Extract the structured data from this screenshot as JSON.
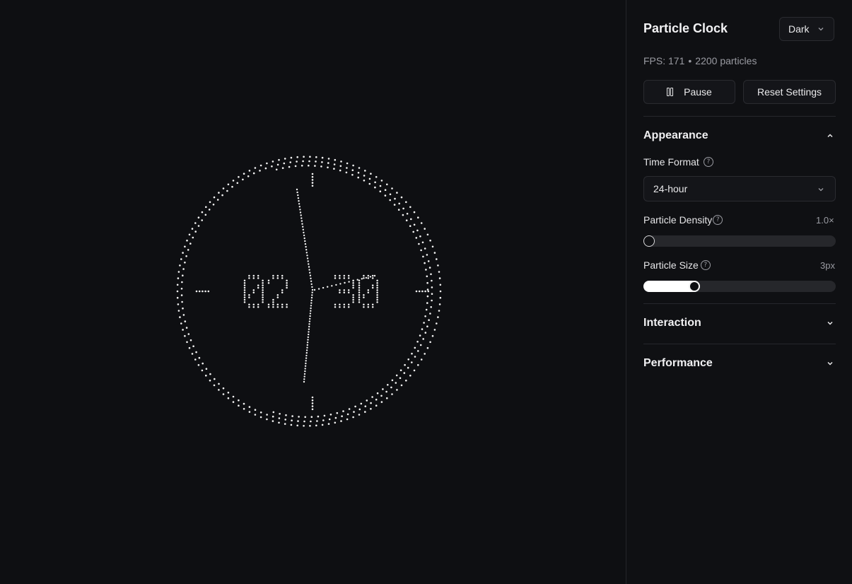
{
  "clock": {
    "hours": "02",
    "minutes": "30"
  },
  "panel": {
    "title": "Particle Clock",
    "theme": "Dark",
    "fps_label": "FPS: 171",
    "particles_label": "2200 particles",
    "pause_label": "Pause",
    "reset_label": "Reset Settings",
    "sections": {
      "appearance": "Appearance",
      "interaction": "Interaction",
      "performance": "Performance"
    },
    "time_format": {
      "label": "Time Format",
      "value": "24-hour"
    },
    "density": {
      "label": "Particle Density",
      "value_text": "1.0×",
      "level": 0.0
    },
    "size": {
      "label": "Particle Size",
      "value_text": "3px",
      "level": 0.25
    }
  },
  "icons": {
    "pause": "pause-icon",
    "help": "help-icon",
    "chevron": "chevron-down-icon"
  }
}
